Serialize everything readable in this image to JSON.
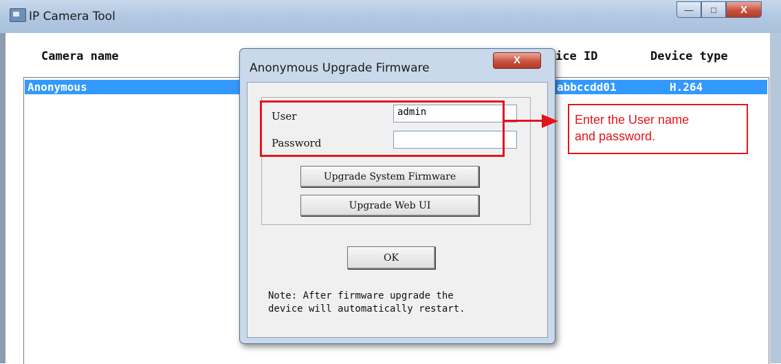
{
  "window": {
    "title": "IP Camera Tool",
    "controls": {
      "minimize": "—",
      "maximize": "□",
      "close": "X"
    }
  },
  "columns": {
    "camera_name": "Camera name",
    "device_id": "ice ID",
    "device_type": "Device type"
  },
  "rows": [
    {
      "camera_name": "Anonymous",
      "device_id": "abbccdd01",
      "device_type": "H.264"
    }
  ],
  "dialog": {
    "title": "Anonymous Upgrade Firmware",
    "close_label": "X",
    "user_label": "User",
    "user_value": "admin",
    "password_label": "Password",
    "password_value": "",
    "upgrade_system_firmware": "Upgrade System Firmware",
    "upgrade_web_ui": "Upgrade Web UI",
    "ok": "OK",
    "note": "Note: After firmware upgrade the\ndevice will automatically restart."
  },
  "annotation": {
    "text_line1": "Enter the User name",
    "text_line2": "and password.",
    "color": "#e3141b"
  },
  "colors": {
    "selection": "#3399ff",
    "dialog_frame": "#c9d8ea",
    "titlebar": "#b4c9e2"
  }
}
